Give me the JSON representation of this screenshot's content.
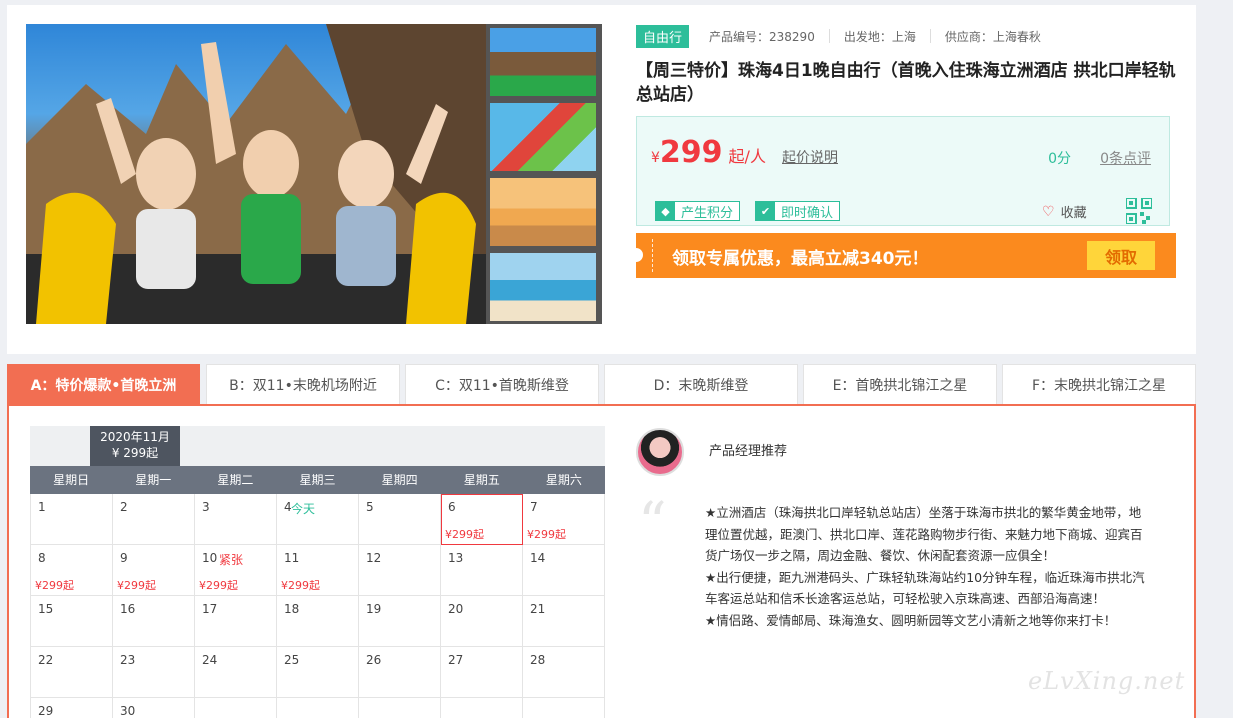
{
  "product": {
    "tag": "自由行",
    "code": "产品编号：238290",
    "departure": "出发地：上海",
    "supplier": "供应商：上海春秋",
    "title": "【周三特价】珠海4日1晚自由行（首晚入住珠海立洲酒店 拱北口岸轻轨总站店）"
  },
  "price": {
    "currency": "¥",
    "amount": "299",
    "unit": "起/人",
    "explain_link": "起价说明",
    "score": "0分",
    "reviews_link": "0条点评",
    "badge_points": "产生积分",
    "badge_confirm": "即时确认",
    "favorite": "收藏"
  },
  "coupon": {
    "text": "领取专属优惠，最高立减340元！",
    "button": "领取"
  },
  "tabs": [
    "A：特价爆款•首晚立洲",
    "B：双11•末晚机场附近",
    "C：双11•首晚斯维登",
    "D：末晚斯维登",
    "E：首晚拱北锦江之星",
    "F：末晚拱北锦江之星"
  ],
  "calendar": {
    "month": "2020年11月",
    "month_price": "¥ 299起",
    "weekdays": [
      "星期日",
      "星期一",
      "星期二",
      "星期三",
      "星期四",
      "星期五",
      "星期六"
    ],
    "today_label": "今天",
    "tight_label": "紧张",
    "cells": [
      {
        "day": "1",
        "price": ""
      },
      {
        "day": "2",
        "price": ""
      },
      {
        "day": "3",
        "price": ""
      },
      {
        "day": "4",
        "price": "",
        "today": true
      },
      {
        "day": "5",
        "price": ""
      },
      {
        "day": "6",
        "price": "¥299起",
        "selected": true
      },
      {
        "day": "7",
        "price": "¥299起"
      },
      {
        "day": "8",
        "price": "¥299起"
      },
      {
        "day": "9",
        "price": "¥299起"
      },
      {
        "day": "10",
        "price": "¥299起",
        "tight": true
      },
      {
        "day": "11",
        "price": "¥299起"
      },
      {
        "day": "12",
        "price": ""
      },
      {
        "day": "13",
        "price": ""
      },
      {
        "day": "14",
        "price": ""
      },
      {
        "day": "15",
        "price": ""
      },
      {
        "day": "16",
        "price": ""
      },
      {
        "day": "17",
        "price": ""
      },
      {
        "day": "18",
        "price": ""
      },
      {
        "day": "19",
        "price": ""
      },
      {
        "day": "20",
        "price": ""
      },
      {
        "day": "21",
        "price": ""
      },
      {
        "day": "22",
        "price": ""
      },
      {
        "day": "23",
        "price": ""
      },
      {
        "day": "24",
        "price": ""
      },
      {
        "day": "25",
        "price": ""
      },
      {
        "day": "26",
        "price": ""
      },
      {
        "day": "27",
        "price": ""
      },
      {
        "day": "28",
        "price": ""
      },
      {
        "day": "29",
        "price": ""
      },
      {
        "day": "30",
        "price": ""
      }
    ]
  },
  "recommend": {
    "title": "产品经理推荐",
    "lines": [
      "★立洲酒店（珠海拱北口岸轻轨总站店）坐落于珠海市拱北的繁华黄金地带，地理位置优越，距澳门、拱北口岸、莲花路购物步行街、来魅力地下商城、迎宾百货广场仅一步之隔，周边金融、餐饮、休闲配套资源一应俱全！",
      "★出行便捷，距九洲港码头、广珠轻轨珠海站约10分钟车程，临近珠海市拱北汽车客运总站和信禾长途客运总站，可轻松驶入京珠高速、西部沿海高速！",
      "★情侣路、爱情邮局、珠海渔女、圆明新园等文艺小清新之地等你来打卡！"
    ]
  },
  "watermark": "eLvXing.net",
  "colors": {
    "accent": "#2dbe9a",
    "price_red": "#f0393f",
    "tab_active": "#f26e52",
    "coupon_orange": "#fb8a1e"
  }
}
